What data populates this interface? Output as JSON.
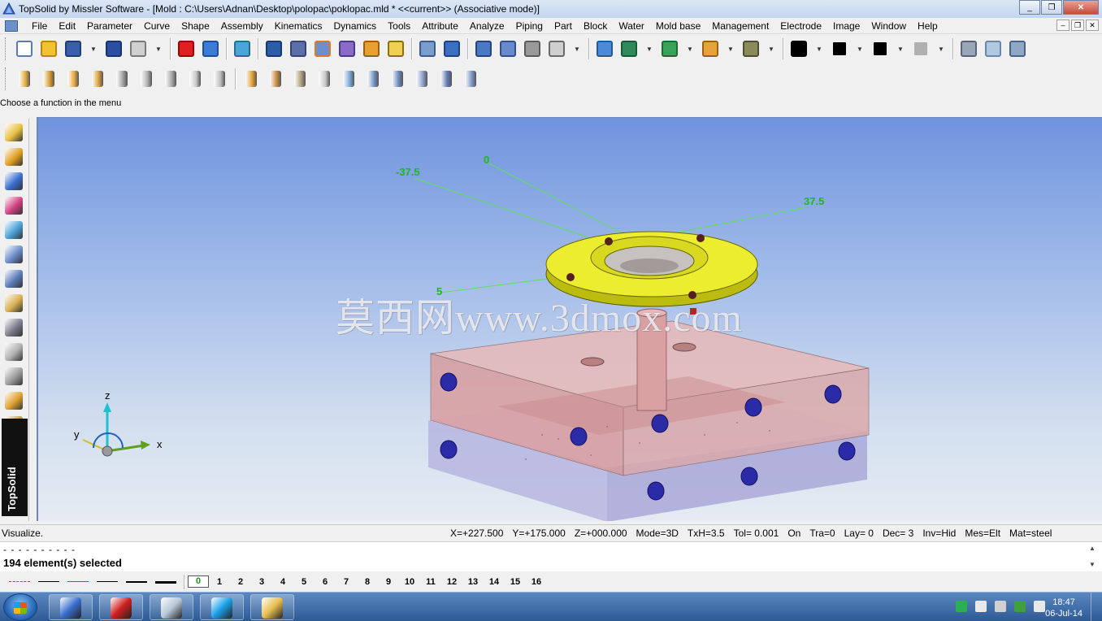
{
  "window": {
    "title": "TopSolid by Missler Software - [Mold : C:\\Users\\Adnan\\Desktop\\polopac\\poklopac.mld *  <<current>> (Associative mode)]",
    "minimize": "_",
    "maximize": "❐",
    "close": "✕"
  },
  "menu": {
    "items": [
      "File",
      "Edit",
      "Parameter",
      "Curve",
      "Shape",
      "Assembly",
      "Kinematics",
      "Dynamics",
      "Tools",
      "Attribute",
      "Analyze",
      "Piping",
      "Part",
      "Block",
      "Water",
      "Mold base",
      "Management",
      "Electrode",
      "Image",
      "Window",
      "Help"
    ],
    "mdi_min": "–",
    "mdi_restore": "❐",
    "mdi_close": "✕"
  },
  "toolbar1": {
    "icons": [
      {
        "name": "new-icon",
        "color": "#ffffff",
        "border": "#5c7aa8"
      },
      {
        "name": "open-icon",
        "color": "#f1c232",
        "border": "#b8860b"
      },
      {
        "name": "save-icon",
        "color": "#3a5fa8",
        "border": "#1f3d78"
      },
      {
        "name": "info-icon",
        "color": "#2a4fa0",
        "border": "#163373"
      },
      {
        "name": "print-icon",
        "color": "#d0d0d0",
        "border": "#7a7a7a"
      },
      {
        "name": "delete-icon",
        "color": "#e02020",
        "border": "#a00000"
      },
      {
        "name": "undo-icon",
        "color": "#3a7bd5",
        "border": "#1e4f9a"
      },
      {
        "name": "regenerate-icon",
        "color": "#4aa6d9",
        "border": "#2a6b8f"
      },
      {
        "name": "visualize-icon",
        "color": "#2c5ba8",
        "border": "#173a72"
      },
      {
        "name": "parameters-icon",
        "color": "#5b6fa8",
        "border": "#34447a"
      },
      {
        "name": "hammer-icon",
        "color": "#6d8fd0",
        "border": "#e07a20"
      },
      {
        "name": "tool-icon",
        "color": "#8a6cc8",
        "border": "#4a3a8a"
      },
      {
        "name": "wrench-icon",
        "color": "#e8a030",
        "border": "#9a6010"
      },
      {
        "name": "measure-icon",
        "color": "#f0d050",
        "border": "#8a7010"
      },
      {
        "name": "pointer-icon",
        "color": "#7a9ccf",
        "border": "#3d5a8a"
      },
      {
        "name": "axis-icon",
        "color": "#3b6fc4",
        "border": "#1e4480"
      },
      {
        "name": "cross-icon",
        "color": "#4a78c2",
        "border": "#24467e"
      },
      {
        "name": "slider-icon",
        "color": "#6a8ad0",
        "border": "#33528a"
      },
      {
        "name": "magnet-icon",
        "color": "#9a9a9a",
        "border": "#5a5a5a"
      },
      {
        "name": "sketch-icon",
        "color": "#cfcfcf",
        "border": "#6a6a6a"
      },
      {
        "name": "zoom-icon",
        "color": "#4a8ad8",
        "border": "#235a9a"
      },
      {
        "name": "zoom-all-icon",
        "color": "#2e8a5a",
        "border": "#195a38"
      },
      {
        "name": "view-icon",
        "color": "#3aa35a",
        "border": "#1e6b36"
      },
      {
        "name": "render-icon",
        "color": "#e8a23a",
        "border": "#9a6216"
      },
      {
        "name": "printer-3d-icon",
        "color": "#8a8a5a",
        "border": "#505030"
      },
      {
        "name": "color-icon",
        "color": "#000000",
        "border": "#000000"
      },
      {
        "name": "point-style-icon",
        "color": "#000000",
        "border": "#f0f0f0"
      },
      {
        "name": "line-style-icon",
        "color": "#000000",
        "border": "#f0f0f0"
      },
      {
        "name": "hatch-icon",
        "color": "#b0b0b0",
        "border": "#f0f0f0"
      },
      {
        "name": "drafting-icon",
        "color": "#9aa6b8",
        "border": "#5a6678"
      },
      {
        "name": "document-icon",
        "color": "#b0c8e0",
        "border": "#6a88a8"
      },
      {
        "name": "assembly-doc-icon",
        "color": "#8fa8c8",
        "border": "#4a6488"
      }
    ]
  },
  "toolbar2": {
    "icons": [
      {
        "name": "screw-icon",
        "color": "#e0b040"
      },
      {
        "name": "bolt-icon",
        "color": "#d89a30"
      },
      {
        "name": "pin-icon",
        "color": "#e8a840"
      },
      {
        "name": "nut-icon",
        "color": "#d8a03a"
      },
      {
        "name": "spring-icon",
        "color": "#a0a0a0"
      },
      {
        "name": "bushing-icon",
        "color": "#b0b0b0"
      },
      {
        "name": "washer-icon",
        "color": "#a8a8a8"
      },
      {
        "name": "sleeve-icon",
        "color": "#c8c8c8"
      },
      {
        "name": "ring-icon",
        "color": "#bcbcbc"
      },
      {
        "name": "standard-part-icon",
        "color": "#e0a030"
      },
      {
        "name": "gear-icon",
        "color": "#c88a40"
      },
      {
        "name": "cylinder-icon",
        "color": "#b0a080"
      },
      {
        "name": "rod-icon",
        "color": "#c8c8c8"
      },
      {
        "name": "bulb-icon",
        "color": "#7aa8d8"
      },
      {
        "name": "thread-icon",
        "color": "#7090c0"
      },
      {
        "name": "ejector-icon",
        "color": "#6a8ac0"
      },
      {
        "name": "dowel-icon",
        "color": "#8aa0c8"
      },
      {
        "name": "clamp-icon",
        "color": "#6078b0"
      },
      {
        "name": "nozzle-icon",
        "color": "#8098c8"
      }
    ]
  },
  "hint": "Choose a function in the menu",
  "vertical_toolbar": {
    "icons": [
      {
        "name": "pencil-icon",
        "color": "#e8c040"
      },
      {
        "name": "curve-icon",
        "color": "#e0a020"
      },
      {
        "name": "solid-icon",
        "color": "#3a6ed0"
      },
      {
        "name": "surface-icon",
        "color": "#d04080"
      },
      {
        "name": "shape-icon",
        "color": "#4aa0d8"
      },
      {
        "name": "assembly-icon",
        "color": "#6a8cc8"
      },
      {
        "name": "component-icon",
        "color": "#5a7ab8"
      },
      {
        "name": "insert-icon",
        "color": "#d8b050"
      },
      {
        "name": "block-icon",
        "color": "#7a7a8a"
      },
      {
        "name": "ejector-pin-icon",
        "color": "#b0b0b0"
      },
      {
        "name": "cooling-icon",
        "color": "#9a9a9a"
      },
      {
        "name": "mold-base-icon",
        "color": "#e0a030"
      },
      {
        "name": "electrode-icon",
        "color": "#c09030"
      },
      {
        "name": "part-icon",
        "color": "#e8a030"
      },
      {
        "name": "slide-icon",
        "color": "#707070"
      }
    ],
    "logo": "TopSolid"
  },
  "viewport": {
    "dim_labels": [
      "-37.5",
      "0",
      "37.5",
      "5"
    ],
    "watermark": "莫西网www.3dmox.com",
    "axis_labels": {
      "z": "z",
      "y": "y",
      "x": "x"
    }
  },
  "status": {
    "message": "Visualize.",
    "fields": [
      "X=+227.500",
      "Y=+175.000",
      "Z=+000.000",
      "Mode=3D",
      "TxH=3.5",
      "Tol= 0.001",
      "On",
      "Tra=0",
      "Lay=  0",
      "Dec= 3",
      "Inv=Hid",
      "Mes=Elt",
      "Mat=steel"
    ]
  },
  "command": {
    "dashes": "- - - - - - - - - -",
    "selection": "194 element(s) selected",
    "scroll_up": "▲",
    "scroll_down": "▼"
  },
  "layers": {
    "line_styles": [
      {
        "color": "#e03030",
        "style": "dashed"
      },
      {
        "color": "#000000",
        "style": "solid"
      },
      {
        "color": "#e03030",
        "style": "solid"
      },
      {
        "color": "#000000",
        "style": "solid"
      },
      {
        "color": "#000000",
        "style": "thick"
      },
      {
        "color": "#000000",
        "style": "thicker"
      }
    ],
    "numbers": [
      "0",
      "1",
      "2",
      "3",
      "4",
      "5",
      "6",
      "7",
      "8",
      "9",
      "10",
      "11",
      "12",
      "13",
      "14",
      "15",
      "16"
    ],
    "active": "0"
  },
  "taskbar": {
    "apps": [
      {
        "name": "topsolid-taskbar-icon",
        "color": "#3a6ed0"
      },
      {
        "name": "solidworks-taskbar-icon",
        "color": "#d02020"
      },
      {
        "name": "calculator-taskbar-icon",
        "color": "#b8c8d8"
      },
      {
        "name": "skype-taskbar-icon",
        "color": "#1aa0e8"
      },
      {
        "name": "paint-taskbar-icon",
        "color": "#e8c050"
      }
    ],
    "tray": [
      {
        "name": "network-icon",
        "color": "#2ab050"
      },
      {
        "name": "volume-icon",
        "color": "#e8e8e8"
      },
      {
        "name": "flag-icon",
        "color": "#d0d0d0"
      },
      {
        "name": "action-center-icon",
        "color": "#40a040"
      },
      {
        "name": "display-icon",
        "color": "#e8e8e8"
      }
    ],
    "time": "18:47",
    "date": "06-Jul-14"
  }
}
